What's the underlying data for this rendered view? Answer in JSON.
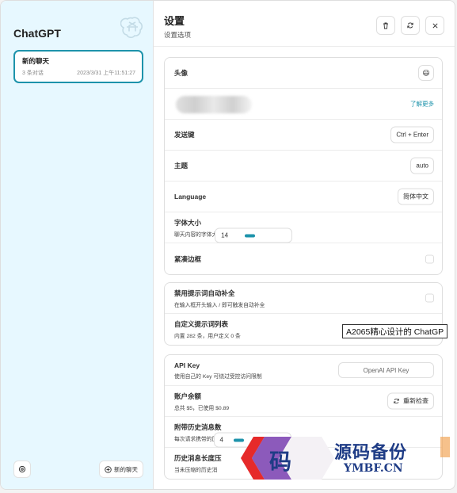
{
  "sidebar": {
    "title": "ChatGPT",
    "chat": {
      "title": "新的聊天",
      "count": "3 条对话",
      "time": "2023/3/31 上午11:51:27"
    },
    "new_chat_label": "新的聊天"
  },
  "header": {
    "title": "设置",
    "subtitle": "设置选项"
  },
  "settings": {
    "avatar_label": "头像",
    "avatar_emoji": "😃",
    "learn_more": "了解更多",
    "send_key_label": "发送键",
    "send_key_value": "Ctrl + Enter",
    "theme_label": "主题",
    "theme_value": "auto",
    "language_label": "Language",
    "language_value": "简体中文",
    "font_size_label": "字体大小",
    "font_size_sub": "聊天内容的字体大小",
    "font_size_value": "14",
    "tight_border_label": "紧凑边框"
  },
  "prompts": {
    "disable_autocomplete_label": "禁用提示词自动补全",
    "disable_autocomplete_sub": "在输入框开头输入 / 即可触发自动补全",
    "custom_list_label": "自定义提示词列表",
    "custom_list_sub": "内置 282 条，用户定义 0 条"
  },
  "api": {
    "key_label": "API Key",
    "key_sub": "使用自己的 Key 可绕过受控访问限制",
    "key_placeholder": "OpenAI API Key",
    "balance_label": "账户余额",
    "balance_sub": "总共 $5，已使用 $0.89",
    "recheck_label": "重新检查",
    "history_count_label": "附带历史消息数",
    "history_count_sub": "每次请求携带的历",
    "history_count_value": "4",
    "compress_label": "历史消息长度压",
    "compress_sub": "当未压缩的历史消"
  },
  "tooltip": "A2065精心设计的 ChatGP",
  "watermark": {
    "glyph": "码",
    "text": "源码备份",
    "url": "YMBF.CN"
  },
  "colors": {
    "accent": "#1d93ab",
    "sidebar_bg": "#e7f8ff"
  }
}
